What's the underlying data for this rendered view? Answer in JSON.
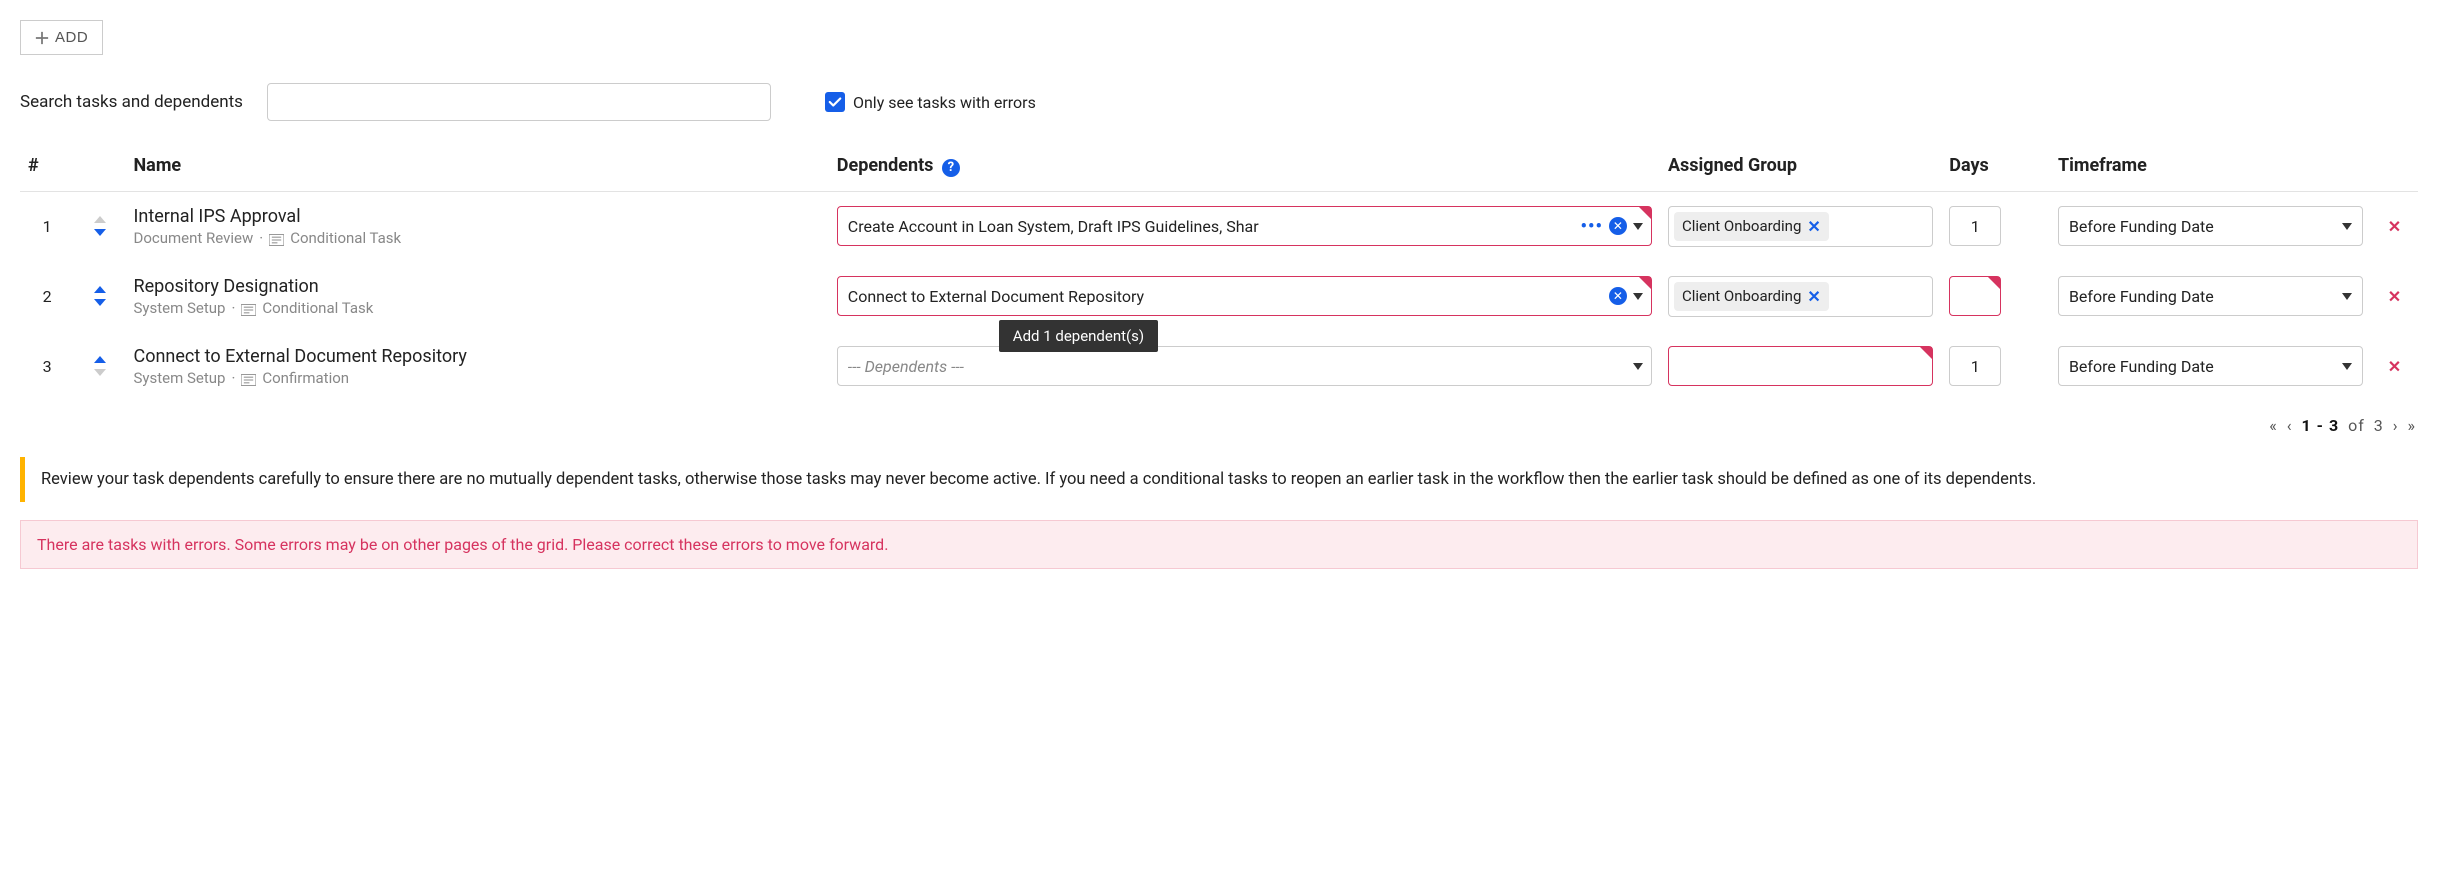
{
  "add_label": "ADD",
  "search_label": "Search tasks and dependents",
  "search_value": "",
  "errors_only_label": "Only see tasks with errors",
  "errors_only_checked": true,
  "headers": {
    "num": "#",
    "name": "Name",
    "deps": "Dependents",
    "group": "Assigned Group",
    "days": "Days",
    "timeframe": "Timeframe"
  },
  "tooltip": "Add 1 dependent(s)",
  "rows": [
    {
      "num": "1",
      "up_disabled": true,
      "down_disabled": false,
      "name": "Internal IPS Approval",
      "sub_category": "Document Review",
      "sub_type": "Conditional Task",
      "deps_text": "Create Account in Loan System, Draft IPS Guidelines, Shar",
      "deps_placeholder": false,
      "deps_error": true,
      "deps_more": true,
      "deps_clear": true,
      "group": "Client Onboarding",
      "group_error": false,
      "days": "1",
      "days_error": false,
      "timeframe": "Before Funding Date"
    },
    {
      "num": "2",
      "up_disabled": false,
      "down_disabled": false,
      "name": "Repository Designation",
      "sub_category": "System Setup",
      "sub_type": "Conditional Task",
      "deps_text": "Connect to External Document Repository",
      "deps_placeholder": false,
      "deps_error": true,
      "deps_more": false,
      "deps_clear": true,
      "group": "Client Onboarding",
      "group_error": false,
      "days": "",
      "days_error": true,
      "timeframe": "Before Funding Date"
    },
    {
      "num": "3",
      "up_disabled": false,
      "down_disabled": true,
      "name": "Connect to External Document Repository",
      "sub_category": "System Setup",
      "sub_type": "Confirmation",
      "deps_text": "--- Dependents ---",
      "deps_placeholder": true,
      "deps_error": false,
      "deps_more": false,
      "deps_clear": false,
      "group": "",
      "group_error": true,
      "days": "1",
      "days_error": false,
      "timeframe": "Before Funding Date"
    }
  ],
  "pager": {
    "range": "1 - 3",
    "of_label": "of",
    "total": "3"
  },
  "info_message": "Review your task dependents carefully to ensure there are no mutually dependent tasks, otherwise those tasks may never become active. If you need a conditional tasks to reopen an earlier task in the workflow then the earlier task should be defined as one of its dependents.",
  "error_message": "There are tasks with errors. Some errors may be on other pages of the grid. Please correct these errors to move forward."
}
